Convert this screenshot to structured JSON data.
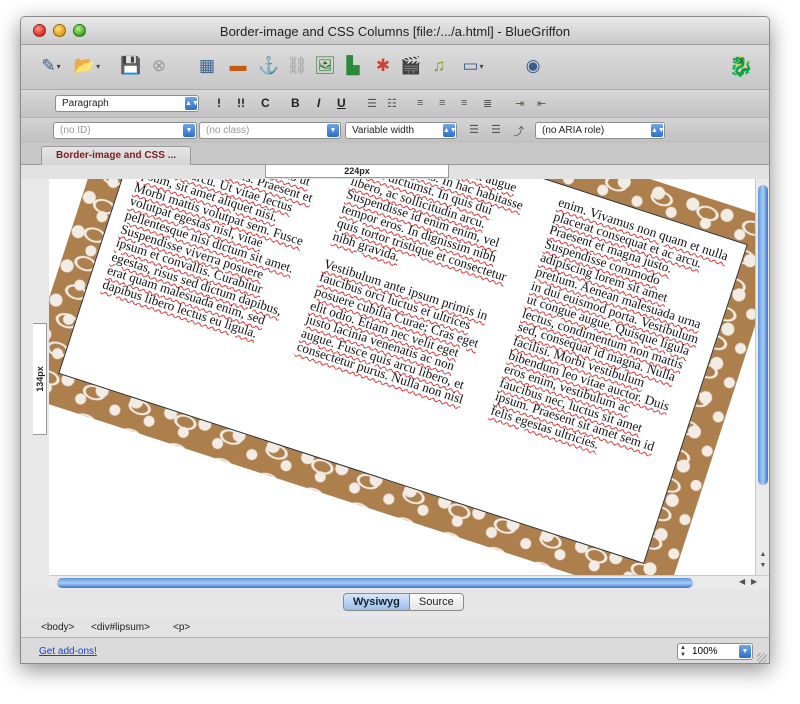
{
  "window": {
    "title": "Border-image and CSS Columns [file:/.../a.html] - BlueGriffon"
  },
  "toolbar": {
    "icons": [
      "new-document-icon",
      "open-icon",
      "save-icon",
      "close-document-icon",
      "table-icon",
      "form-icon",
      "anchor-icon",
      "link-icon",
      "image-icon",
      "chart-icon",
      "paint-icon",
      "video-icon",
      "audio-icon",
      "window-icon",
      "globe-icon",
      "griffon-logo-icon"
    ]
  },
  "format_bar": {
    "paragraph_select": "Paragraph",
    "btn_important": "!",
    "btn_very_important": "!!",
    "btn_code": "C",
    "btn_bold": "B",
    "btn_italic": "I",
    "btn_underline": "U"
  },
  "id_bar": {
    "id_select": "(no ID)",
    "class_select": "(no class)",
    "width_select": "Variable width",
    "aria_select": "(no ARIA role)"
  },
  "tabs": [
    {
      "label": "Border-image and CSS ..."
    }
  ],
  "rulers": {
    "width_label": "224px",
    "height_label": "134px"
  },
  "document": {
    "paragraphs": [
      "Lorem ipsum dolor sit amet, consectetur adipiscing elit. Donec consequat quam id quam fringilla ac accumsan nisi facilisis. Etiam lobortis justo ut erat pretium facilisis. Praesent et interdum arcu. Ut vitae lectus ipsum, sit amet aliquet nisi. Morbi mattis volutpat sem. Fusce volutpat egestas nisl, vitae pellentesque nisi dictum sit amet. Suspendisse viverra posuere ipsum et convallis. Curabitur egestas, risus sed dictum dapibus, erat quam malesuada enim, sed dapibus libero lectus eu ligula. Cras nec lectus sit amet augue laoreet dapibus. In hac habitasse platea dictumst. In quis dui libero, ac sollicitudin arcu. Suspendisse id enim enim, vel tempor eros. In dignissim nibh quis tortor tristique et consectetur nibh gravida.",
      "Vestibulum ante ipsum primis in faucibus orci luctus et ultrices posuere cubilia Curae; Cras eget elit odio. Etiam nec velit eget justo lacinia venenatis ac non augue. Fusce quis arcu libero, et consectetur purus. Nulla non nisl enim. Vivamus non quam et nulla placerat consequat et ac arcu. Praesent et magna justo. Suspendisse commodo adipiscing lorem sit amet pretium. Aenean malesuada urna in dui euismod porta. Vestibulum ut congue augue. Quisque ligula lectus, condimentum non mattis sed, consequat id magna. Nulla facilisi. Morbi vestibulum bibendum leo vitae auctor. Duis eros enim, vestibulum ac faucibus nec, luctus sit amet ipsum. Praesent sit amet sem id felis egestas ultricies."
    ]
  },
  "view_modes": {
    "wysiwyg": "Wysiwyg",
    "source": "Source"
  },
  "element_path": [
    "<body>",
    "<div#lipsum>",
    "<p>"
  ],
  "status": {
    "addons_link": "Get add-ons!",
    "zoom": "100%"
  },
  "colors": {
    "border_pattern": "#ad7f4d",
    "link": "#1a44c8",
    "scroll_thumb": "#5c95dd"
  }
}
